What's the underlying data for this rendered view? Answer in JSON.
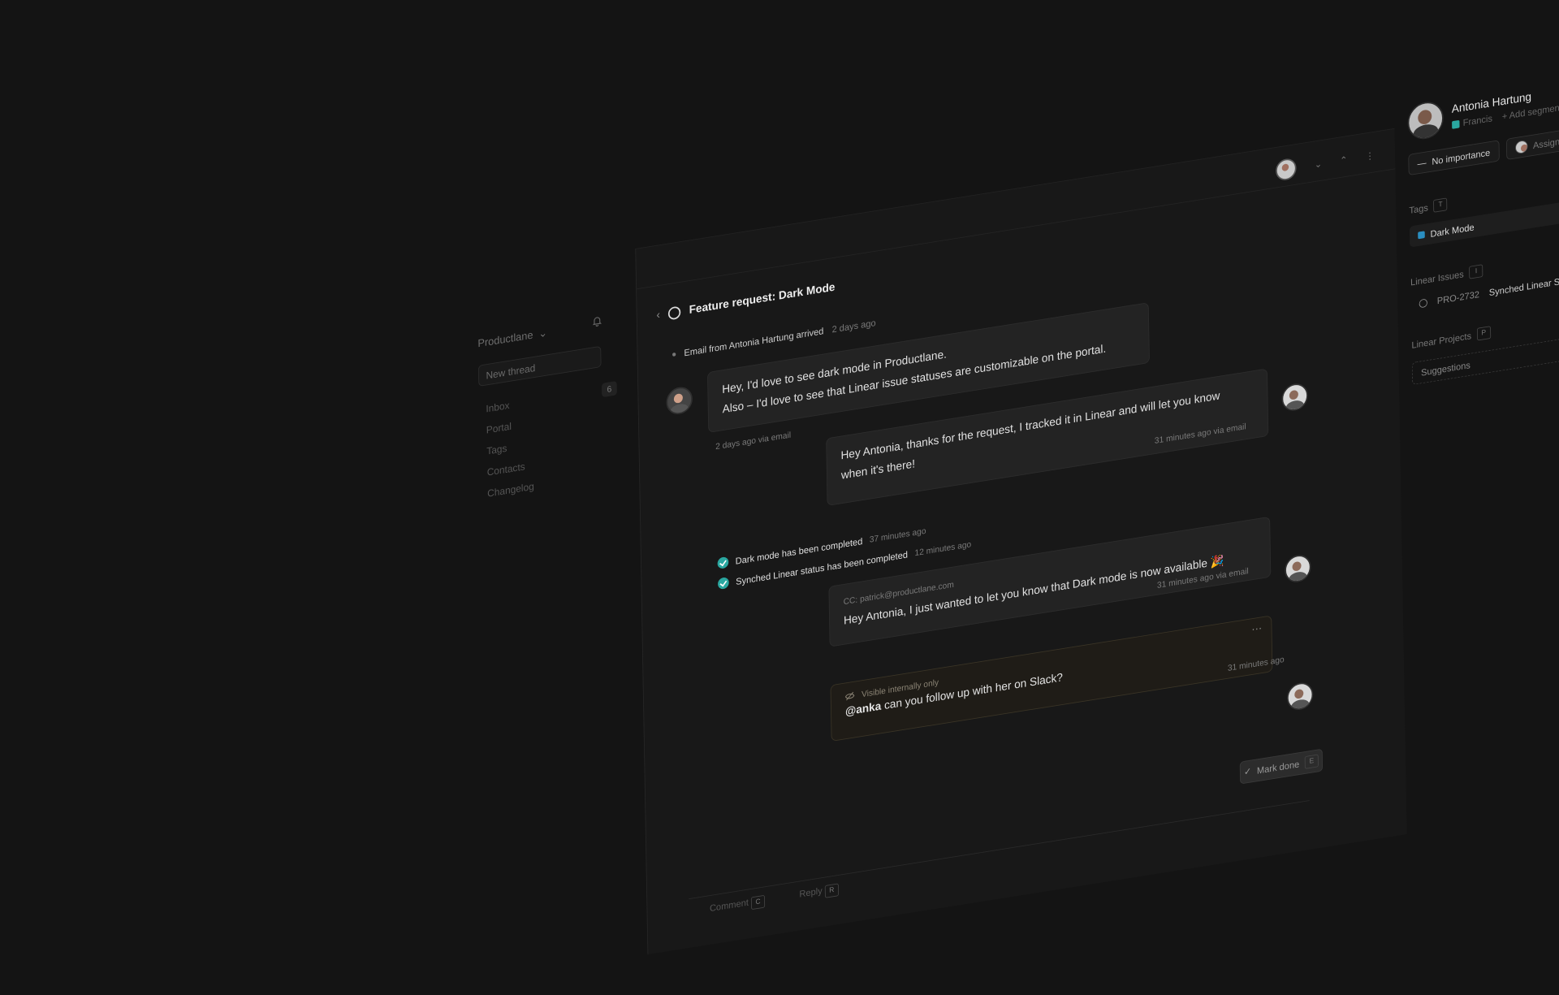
{
  "sidebar": {
    "workspace": "Productlane",
    "new_thread": "New thread",
    "items": [
      {
        "label": "Inbox",
        "badge": "6"
      },
      {
        "label": "Portal"
      },
      {
        "label": "Tags"
      },
      {
        "label": "Contacts"
      },
      {
        "label": "Changelog"
      }
    ]
  },
  "thread": {
    "title": "Feature request: Dark Mode",
    "event": {
      "text": "Email from Antonia Hartung arrived",
      "time": "2 days ago"
    },
    "messages": [
      {
        "line1": "Hey, I'd love to see dark mode in Productlane.",
        "line2": "Also – I'd love to see that Linear issue statuses are customizable on the portal.",
        "meta": "2 days ago via email"
      },
      {
        "line1": "Hey Antonia, thanks for the request, I tracked it in Linear and will let you know",
        "line2": "when it's there!",
        "meta": "31 minutes ago via email"
      }
    ],
    "statuses": [
      {
        "text": "Dark mode has been completed",
        "time": "37 minutes ago"
      },
      {
        "text": "Synched Linear status has been completed",
        "time": "12 minutes ago"
      }
    ],
    "cc_message": {
      "cc": "CC: patrick@productlane.com",
      "text": "Hey Antonia, I just wanted to let you know that Dark mode is now available 🎉",
      "meta": "31 minutes ago via email"
    },
    "internal_note": {
      "visibility": "Visible internally only",
      "mention": "@anka",
      "text": " can you follow up with her on Slack?",
      "meta": "31 minutes ago",
      "more": "…"
    },
    "mark_done": "Mark done",
    "mark_done_key": "E",
    "composer": {
      "comment": "Comment",
      "comment_key": "C",
      "reply": "Reply",
      "reply_key": "R"
    }
  },
  "contact": {
    "name": "Antonia Hartung",
    "segment": "Francis",
    "add_segment": "+ Add segment",
    "importance": "No importance",
    "assigned": "Assigned to me",
    "tags_label": "Tags",
    "tags_key": "T",
    "tag": "Dark Mode",
    "linear_issues_label": "Linear Issues",
    "linear_issues_key": "I",
    "issue_id": "PRO-2732",
    "issue_title": "Synched Linear Status",
    "linear_projects_label": "Linear Projects",
    "linear_projects_key": "P",
    "suggestions": "Suggestions"
  },
  "colors": {
    "accent": "#2aa7a0",
    "background": "#141414",
    "panel": "#181818"
  }
}
